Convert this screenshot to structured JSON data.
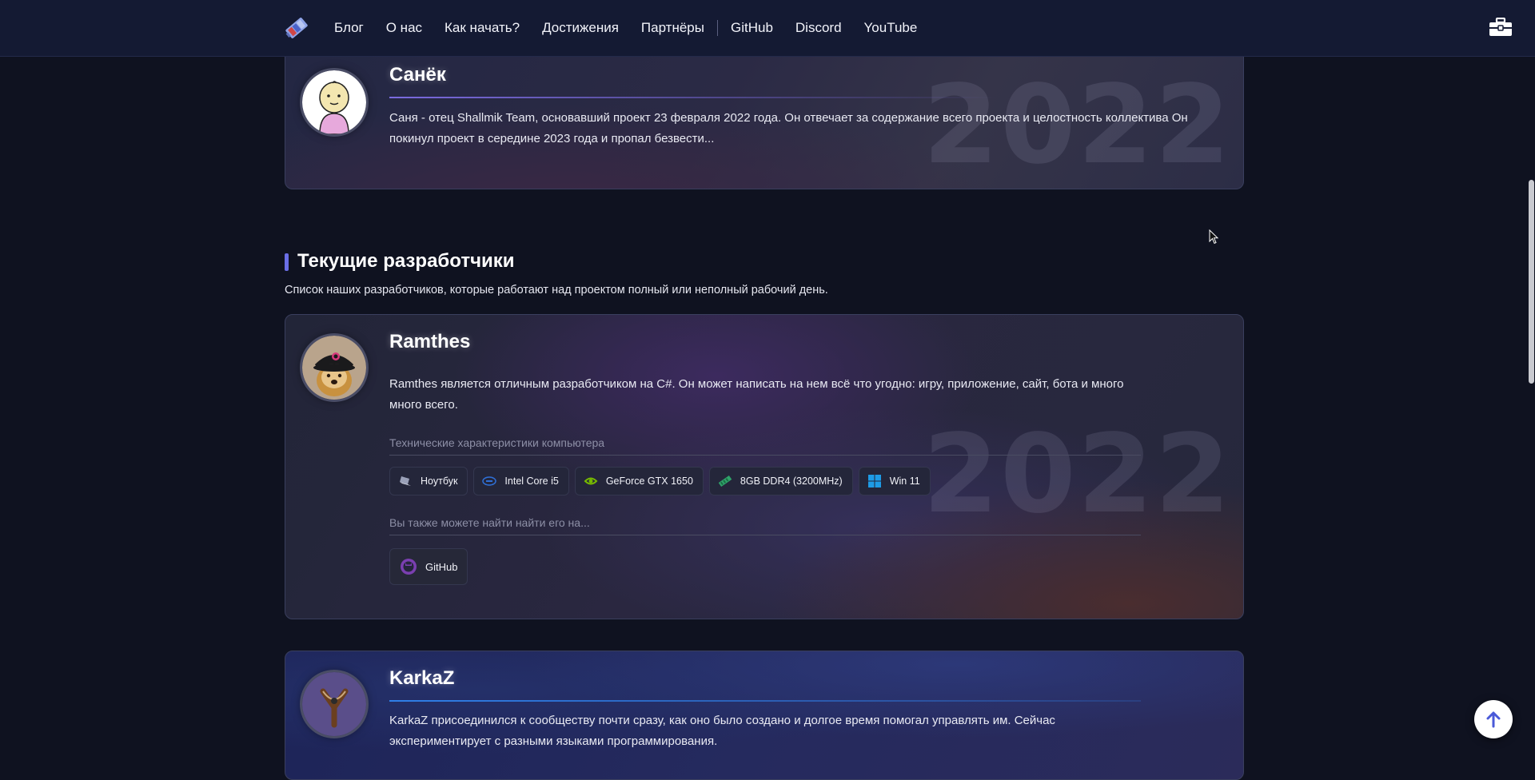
{
  "nav": {
    "items": [
      "Блог",
      "О нас",
      "Как начать?",
      "Достижения",
      "Партнёры"
    ],
    "external": [
      "GitHub",
      "Discord",
      "YouTube"
    ]
  },
  "icons": {
    "logo": "site-logo-icon",
    "toolbox": "toolbox-icon",
    "scroll_top": "arrow-up-icon"
  },
  "colors": {
    "accent": "#6a6ee6",
    "background": "#0f1220",
    "topbar": "#141a33"
  },
  "former": {
    "name": "Санёк",
    "year": "2022",
    "description": "Саня - отец Shallmik Team, основавший проект 23 февраля 2022 года. Он отвечает за содержание всего проекта и целостность коллектива Он покинул проект в середине 2023 года и пропал безвести..."
  },
  "section": {
    "title": "Текущие разработчики",
    "subtitle": "Список наших разработчиков, которые работают над проектом полный или неполный рабочий день."
  },
  "ramthes": {
    "name": "Ramthes",
    "year": "2022",
    "description": "Ramthes является отличным разработчиком на C#. Он может написать на нем всё что угодно: игру, приложение, сайт, бота и много много всего.",
    "specs_heading": "Технические характеристики компьютера",
    "specs": [
      {
        "label": "Ноутбук",
        "icon": "laptop-icon"
      },
      {
        "label": "Intel Core i5",
        "icon": "intel-icon"
      },
      {
        "label": "GeForce GTX 1650",
        "icon": "nvidia-icon"
      },
      {
        "label": "8GB DDR4 (3200MHz)",
        "icon": "ram-icon"
      },
      {
        "label": "Win 11",
        "icon": "windows-icon"
      }
    ],
    "links_heading": "Вы также можете найти найти его на...",
    "links": [
      {
        "label": "GitHub",
        "icon": "github-icon"
      }
    ]
  },
  "karkaz": {
    "name": "KarkaZ",
    "description": "KarkaZ присоединился к сообществу почти сразу, как оно было создано и долгое время помогал управлять им. Сейчас экспериментирует с разными языками программирования."
  }
}
